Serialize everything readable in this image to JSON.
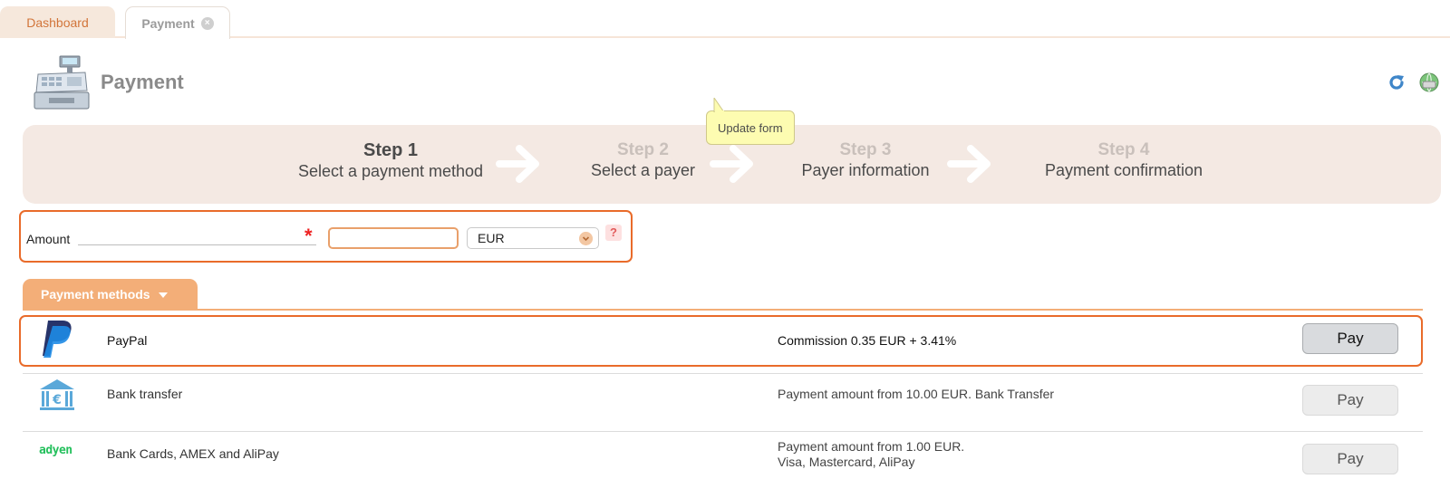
{
  "tabs": {
    "dashboard": "Dashboard",
    "payment": "Payment",
    "close_glyph": "×"
  },
  "header": {
    "title": "Payment",
    "icons": [
      "cash-register-icon",
      "refresh-icon",
      "help-globe-icon"
    ]
  },
  "tooltip": "Update form",
  "steps": [
    {
      "num": "Step 1",
      "desc": "Select a payment method",
      "active": true
    },
    {
      "num": "Step 2",
      "desc": "Select a payer",
      "active": false
    },
    {
      "num": "Step 3",
      "desc": "Payer information",
      "active": false
    },
    {
      "num": "Step 4",
      "desc": "Payment confirmation",
      "active": false
    }
  ],
  "amount": {
    "label": "Amount",
    "value": "",
    "required_mark": "*",
    "currency": "EUR",
    "help": "?"
  },
  "methods": {
    "tab_label": "Payment methods",
    "items": [
      {
        "icon": "paypal-icon",
        "name": "PayPal",
        "commission": "Commission 0.35 EUR + 3.41%",
        "commission_line2": "",
        "button": "Pay",
        "highlighted": true
      },
      {
        "icon": "bank-transfer-icon",
        "name": "Bank transfer",
        "commission": "Payment amount from 10.00 EUR. Bank Transfer",
        "commission_line2": "",
        "button": "Pay",
        "highlighted": false
      },
      {
        "icon": "adyen-logo",
        "logo_text": "adyen",
        "name": "Bank Cards, AMEX and AliPay",
        "commission": "Payment amount from 1.00 EUR.",
        "commission_line2": "Visa, Mastercard, AliPay",
        "button": "Pay",
        "highlighted": false
      }
    ]
  },
  "colors": {
    "accent": "#e96b2a",
    "tab_bg": "#f3ae78",
    "steps_bg": "#f4e9e3",
    "tooltip_bg": "#fdfcb1"
  }
}
